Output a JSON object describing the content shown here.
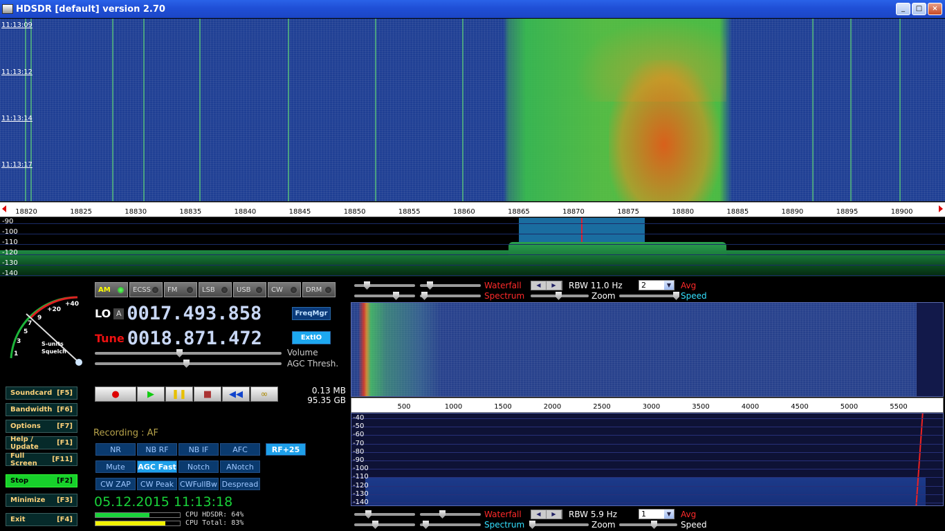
{
  "window": {
    "title": "HDSDR [default]  version 2.70",
    "buttons": [
      "_",
      "□",
      "×"
    ]
  },
  "waterfall": {
    "timestamps": [
      "11:13:09",
      "11:13:12",
      "11:13:14",
      "11:13:17"
    ]
  },
  "freq_scale": {
    "ticks": [
      "18820",
      "18825",
      "18830",
      "18835",
      "18840",
      "18845",
      "18850",
      "18855",
      "18860",
      "18865",
      "18870",
      "18875",
      "18880",
      "18885",
      "18890",
      "18895",
      "18900"
    ]
  },
  "spectrum": {
    "levels": [
      "-90",
      "-100",
      "-110",
      "-120",
      "-130",
      "-140"
    ]
  },
  "smeter": {
    "scale": [
      "+40",
      "+20",
      "9",
      "7",
      "5",
      "3",
      "1"
    ],
    "label1": "S-units",
    "label2": "Squelch"
  },
  "modes": [
    {
      "label": "AM",
      "active": true
    },
    {
      "label": "ECSS",
      "active": false
    },
    {
      "label": "FM",
      "active": false
    },
    {
      "label": "LSB",
      "active": false
    },
    {
      "label": "USB",
      "active": false
    },
    {
      "label": "CW",
      "active": false
    },
    {
      "label": "DRM",
      "active": false
    }
  ],
  "lo": {
    "label": "LO",
    "vfo": "A",
    "frequency": "0017.493.858"
  },
  "tune": {
    "label": "Tune",
    "frequency": "0018.871.472"
  },
  "buttons_top": {
    "freqmgr": "FreqMgr",
    "extio": "ExtIO"
  },
  "sliders": {
    "volume": "Volume",
    "agc": "AGC Thresh."
  },
  "transport": {
    "record": "●",
    "play": "▶",
    "pause": "❚❚",
    "stop": "■",
    "rewind": "◀◀",
    "loop": "∞"
  },
  "disk": {
    "size": "0.13 MB",
    "free": "95.35 GB"
  },
  "menu": [
    {
      "label": "Soundcard",
      "key": "[F5]"
    },
    {
      "label": "Bandwidth",
      "key": "[F6]"
    },
    {
      "label": "Options",
      "key": "[F7]"
    },
    {
      "label": "Help / Update",
      "key": "[F1]"
    },
    {
      "label": "Full Screen",
      "key": "[F11]"
    },
    {
      "label": "Stop",
      "key": "[F2]"
    },
    {
      "label": "Minimize",
      "key": "[F3]"
    },
    {
      "label": "Exit",
      "key": "[F4]"
    }
  ],
  "recording": "Recording : AF",
  "dsp": {
    "row1": [
      "NR",
      "NB RF",
      "NB IF",
      "AFC",
      "RF+25"
    ],
    "row2": [
      "Mute",
      "AGC Fast",
      "Notch",
      "ANotch"
    ],
    "row3": [
      "CW ZAP",
      "CW Peak",
      "CWFullBw",
      "Despread"
    ]
  },
  "datetime": "05.12.2015 11:13:18",
  "cpu": {
    "hdsdr_label": "CPU HDSDR: 64%",
    "total_label": "CPU Total: 83%",
    "hdsdr": 0.64,
    "total": 0.83,
    "hdsdr_color": "#19d23a",
    "total_color": "#f2f200"
  },
  "af_controls_top": {
    "waterfall": "Waterfall",
    "spectrum": "Spectrum",
    "rbw": "RBW 11.0 Hz",
    "avg_value": "2",
    "avg": "Avg",
    "zoom": "Zoom",
    "speed": "Speed"
  },
  "af_controls_bottom": {
    "waterfall": "Waterfall",
    "spectrum": "Spectrum",
    "rbw": "RBW  5.9 Hz",
    "avg_value": "1",
    "avg": "Avg",
    "zoom": "Zoom",
    "speed": "Speed"
  },
  "af_scale": {
    "ticks": [
      "500",
      "1000",
      "1500",
      "2000",
      "2500",
      "3000",
      "3500",
      "4000",
      "4500",
      "5000",
      "5500"
    ]
  },
  "af_spectrum": {
    "levels": [
      "-40",
      "-50",
      "-60",
      "-70",
      "-80",
      "-90",
      "-100",
      "-110",
      "-120",
      "-130",
      "-140"
    ]
  }
}
